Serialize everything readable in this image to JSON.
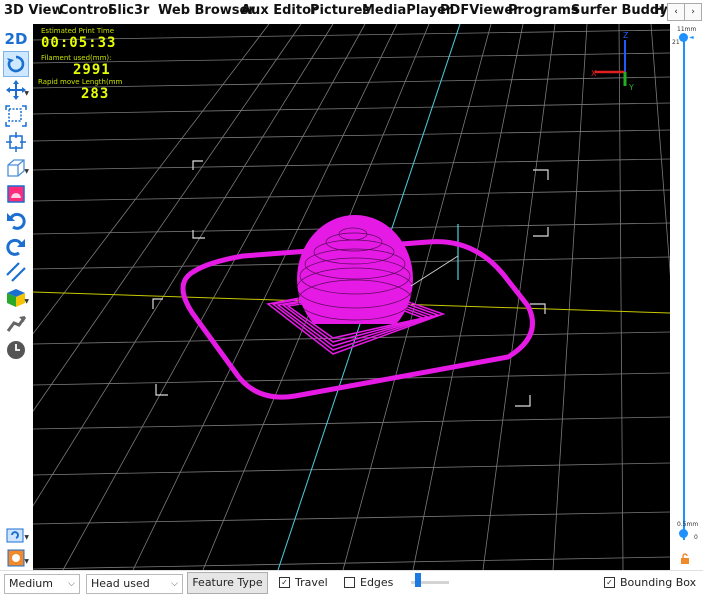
{
  "tabs": [
    "3D View",
    "Control",
    "Slic3r",
    "Web Browser",
    "Aux Editor",
    "Pictures",
    "MediaPlayer",
    "PDFViewer",
    "Programs",
    "Surfer Buddy",
    "H"
  ],
  "tab_scroll": {
    "left": "‹",
    "right": "›"
  },
  "left_toolbar": {
    "mode_label": "2D",
    "tools": [
      "rotate-icon",
      "move-icon",
      "fit-view-icon",
      "fit-selection-icon",
      "view-cube-icon",
      "layer-view-icon",
      "undo-icon",
      "redo-icon",
      "slice-lines-icon",
      "color-cube-icon",
      "tool-path-icon",
      "clock-icon",
      "help-icon",
      "object-icon"
    ]
  },
  "stats": {
    "print_time_label": "Estimated Print Time",
    "print_time_value": "00:05:33",
    "filament_label": "Filament used(mm):",
    "filament_value": "2991",
    "rapid_label": "Rapid move Length(mm",
    "rapid_value": "283"
  },
  "axes": {
    "x": "X",
    "y": "Y",
    "z": "Z"
  },
  "layer_slider": {
    "top_label": "11mm",
    "top_value": "21",
    "bottom_label": "0.5mm",
    "bottom_value": "0",
    "track_color": "#1e90ff"
  },
  "bottom": {
    "quality_select": "Medium",
    "color_mode_select": "Head used",
    "feature_button": "Feature Type",
    "travel_label": "Travel",
    "travel_checked": true,
    "edges_label": "Edges",
    "edges_checked": false,
    "bounding_box_label": "Bounding Box",
    "bounding_box_checked": true
  },
  "colors": {
    "toolpath": "#e51ae5",
    "grid": "#8a8a8a",
    "background": "#000000",
    "stats_text": "#e6ff00"
  }
}
